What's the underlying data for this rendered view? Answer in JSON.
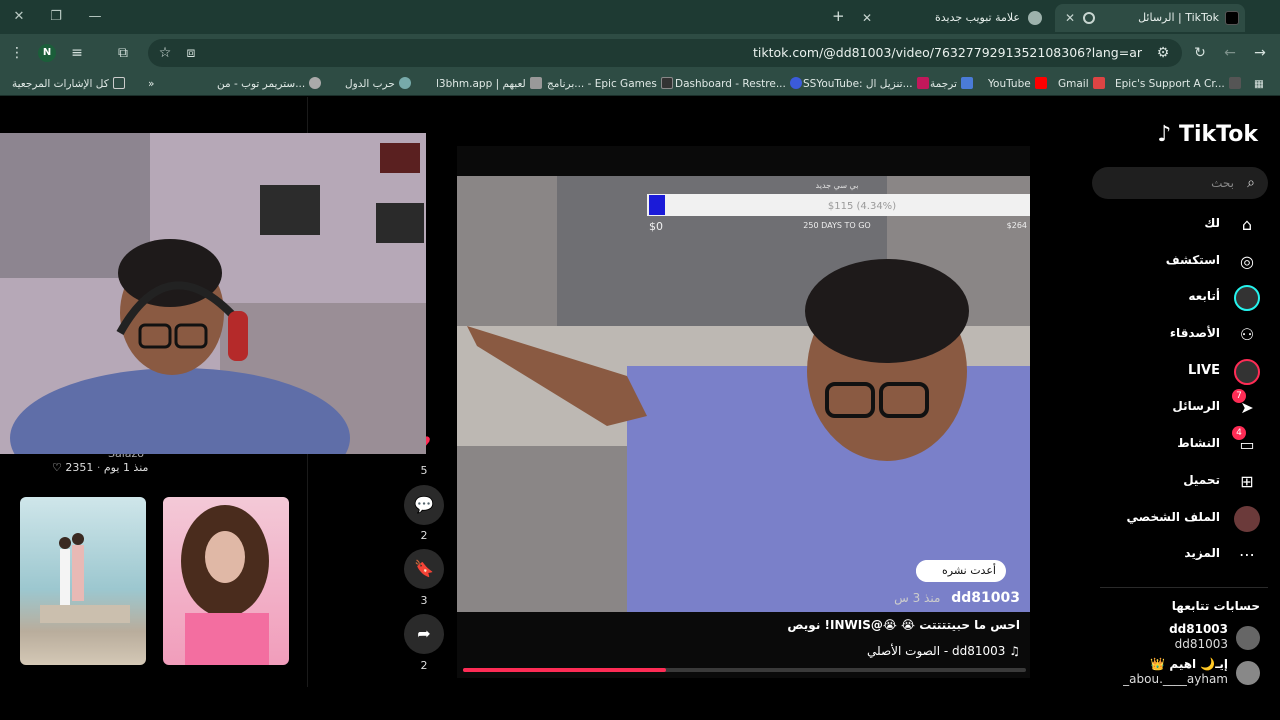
{
  "browser": {
    "tabs": [
      {
        "title": "الرسائل | TikTok",
        "active": true
      },
      {
        "title": "علامة تبويب جديدة",
        "active": false
      }
    ],
    "url": "tiktok.com/@dd81003/video/7632779291352108306?lang=ar",
    "profile_initial": "N",
    "bookmarks": [
      "Epic's Support A Cr...",
      "Gmail",
      "YouTube",
      "ترجمة",
      "SSYouTube: تنزيل ال...",
      "Dashboard - Restre...",
      "برنامج... - Epic Games",
      "l3bhm.app | لعبهم",
      "حرب الدول",
      "ستريمر توب - من...",
      "كل الإشارات المرجعية"
    ]
  },
  "sidebar": {
    "logo": "TikTok",
    "search_placeholder": "بحث",
    "nav": [
      {
        "label": "لك",
        "icon": "home-icon"
      },
      {
        "label": "استكشف",
        "icon": "compass-icon"
      },
      {
        "label": "أتابعه",
        "icon": "following-avatar-icon"
      },
      {
        "label": "الأصدقاء",
        "icon": "friends-icon"
      },
      {
        "label": "LIVE",
        "icon": "live-icon"
      },
      {
        "label": "الرسائل",
        "icon": "messages-icon",
        "badge": "7"
      },
      {
        "label": "النشاط",
        "icon": "activity-icon",
        "badge": "4"
      },
      {
        "label": "تحميل",
        "icon": "upload-icon"
      },
      {
        "label": "الملف الشخصي",
        "icon": "profile-avatar-icon"
      },
      {
        "label": "المزيد",
        "icon": "more-icon"
      }
    ],
    "following_title": "حسابات تتابعها",
    "following": [
      {
        "name": "dd81003",
        "handle": "dd81003"
      },
      {
        "name": "إيـ🌙 اهيم 👑",
        "handle": "abou.____ayham_"
      }
    ]
  },
  "left": {
    "creator_partial": "Salazo",
    "likes": "2351",
    "ago": "منذ 1 يوم"
  },
  "actions": [
    {
      "icon": "heart-icon",
      "count": "5"
    },
    {
      "icon": "comment-icon",
      "count": "2"
    },
    {
      "icon": "bookmark-icon",
      "count": "3"
    },
    {
      "icon": "share-icon",
      "count": "2"
    }
  ],
  "video": {
    "repost_label": "أعدت نشره",
    "author": "dd81003",
    "ago": "منذ 3 س",
    "caption": "احس ما حبيتتتتت 😭 😭@INWIS! نويص",
    "sound": "♫ dd81003 - الصوت الأصلي",
    "overlay_goal_left": "$0",
    "overlay_goal_right": "$264",
    "overlay_days": "250 DAYS TO GO",
    "overlay_title": "بي سي جديد",
    "overlay_amount": "$115 (4.34%)",
    "progress_fraction": 0.36
  }
}
